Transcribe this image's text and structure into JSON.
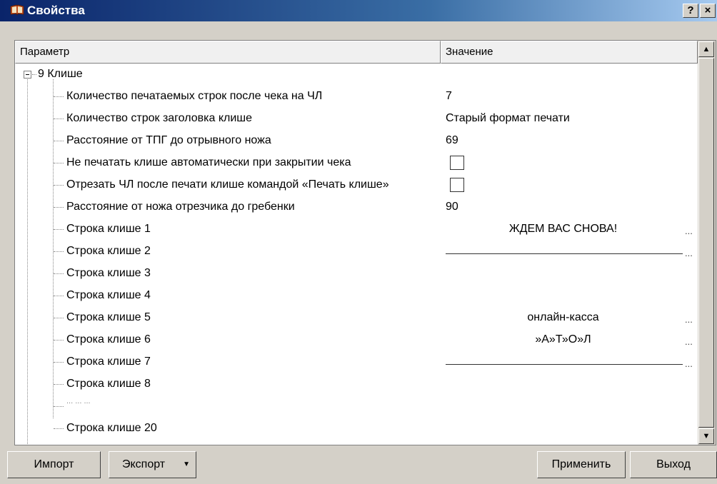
{
  "window": {
    "title": "Свойства",
    "help_label": "?",
    "close_label": "×"
  },
  "table": {
    "headers": {
      "param": "Параметр",
      "value": "Значение"
    },
    "group": {
      "label": "9 Клише",
      "expanded": true
    },
    "rows": [
      {
        "label": "Количество печатаемых строк после чека на ЧЛ",
        "value": "7"
      },
      {
        "label": "Количество строк заголовка клише",
        "value": "Старый формат печати"
      },
      {
        "label": "Расстояние от ТПГ до отрывного ножа",
        "value": "69"
      },
      {
        "label": "Не печатать клише автоматически при закрытии чека",
        "checked": false
      },
      {
        "label": "Отрезать ЧЛ после печати клише командой «Печать клише»",
        "checked": false
      },
      {
        "label": "Расстояние от ножа отрезчика до гребенки",
        "value": "90"
      },
      {
        "label": "Строка клише 1",
        "value": "ЖДЕМ ВАС СНОВА!",
        "ellipsis": "..."
      },
      {
        "label": "Строка клише 2",
        "ellipsis": "..."
      },
      {
        "label": "Строка клише 3"
      },
      {
        "label": "Строка клише 4"
      },
      {
        "label": "Строка клише 5",
        "value": "онлайн-касса",
        "ellipsis": "..."
      },
      {
        "label": "Строка клише 6",
        "value": "»А»Т»О»Л",
        "ellipsis": "..."
      },
      {
        "label": "Строка клише 7",
        "ellipsis": "..."
      },
      {
        "label": "Строка клише 8"
      },
      {
        "label": "... ... ..."
      },
      {
        "label": "Строка клише 20"
      }
    ]
  },
  "buttons": {
    "import": "Импорт",
    "export": "Экспорт",
    "apply": "Применить",
    "exit": "Выход"
  },
  "scroll": {
    "up_label": "▲",
    "down_label": "▼"
  },
  "colors": {
    "titlebar_start": "#0a246a",
    "titlebar_end": "#a6caf0",
    "face": "#d4d0c8"
  },
  "icons": {
    "title": "book-icon",
    "dropdown": "dropdown-arrow-icon"
  }
}
